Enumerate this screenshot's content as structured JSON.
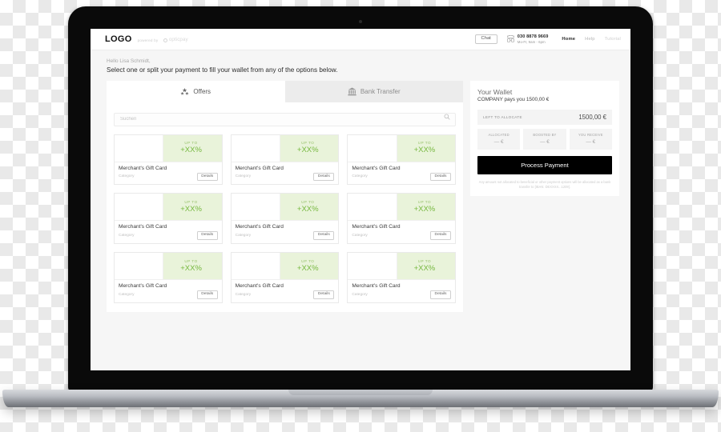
{
  "header": {
    "logo": "LOGO",
    "powered_by": "powered by",
    "provider_name": "opticpay",
    "provider_icon": "circle-logo-icon",
    "chat_label": "Chat",
    "phone_icon": "phone-support-icon",
    "phone_number": "030 8878 9669",
    "phone_hours": "Mo-Fr, 9am - 6pm",
    "nav": [
      {
        "label": "Home",
        "state": "active"
      },
      {
        "label": "Help",
        "state": "dim"
      },
      {
        "label": "Tutorial",
        "state": "dimmer"
      }
    ]
  },
  "greeting": {
    "hello": "Hello Lisa Schmidt,",
    "instruction": "Select one or split your payment to fill your wallet from any of the options below."
  },
  "tabs": [
    {
      "label": "Offers",
      "icon": "stars-icon",
      "active": true
    },
    {
      "label": "Bank Transfer",
      "icon": "bank-icon",
      "active": false
    }
  ],
  "search": {
    "placeholder": "Suchen",
    "value": "",
    "icon": "search-icon"
  },
  "offers": {
    "card_template": {
      "boost_prefix": "UP TO",
      "boost_value": "+XX%",
      "title": "Merchant's Gift Card",
      "category": "Category",
      "details_label": "Details"
    },
    "cards": [
      {
        "boost_prefix": "UP TO",
        "boost_value": "+XX%",
        "title": "Merchant's Gift Card",
        "category": "Category",
        "details_label": "Details"
      },
      {
        "boost_prefix": "UP TO",
        "boost_value": "+XX%",
        "title": "Merchant's Gift Card",
        "category": "Category",
        "details_label": "Details"
      },
      {
        "boost_prefix": "UP TO",
        "boost_value": "+XX%",
        "title": "Merchant's Gift Card",
        "category": "Category",
        "details_label": "Details"
      },
      {
        "boost_prefix": "UP TO",
        "boost_value": "+XX%",
        "title": "Merchant's Gift Card",
        "category": "Category",
        "details_label": "Details"
      },
      {
        "boost_prefix": "UP TO",
        "boost_value": "+XX%",
        "title": "Merchant's Gift Card",
        "category": "Category",
        "details_label": "Details"
      },
      {
        "boost_prefix": "UP TO",
        "boost_value": "+XX%",
        "title": "Merchant's Gift Card",
        "category": "Category",
        "details_label": "Details"
      },
      {
        "boost_prefix": "UP TO",
        "boost_value": "+XX%",
        "title": "Merchant's Gift Card",
        "category": "Category",
        "details_label": "Details"
      },
      {
        "boost_prefix": "UP TO",
        "boost_value": "+XX%",
        "title": "Merchant's Gift Card",
        "category": "Category",
        "details_label": "Details"
      },
      {
        "boost_prefix": "UP TO",
        "boost_value": "+XX%",
        "title": "Merchant's Gift Card",
        "category": "Category",
        "details_label": "Details"
      }
    ]
  },
  "wallet": {
    "title": "Your Wallet",
    "subtitle": "COMPANY pays you 1500,00 €",
    "left_to_allocate_label": "LEFT TO ALLOCATE",
    "left_to_allocate_amount": "1500,00 €",
    "stats": [
      {
        "label": "ALLOCATED",
        "value": "— €"
      },
      {
        "label": "BOOSTED BY",
        "value": "— €"
      },
      {
        "label": "YOU RECEIVE",
        "value": "— €"
      }
    ],
    "process_payment_label": "Process Payment",
    "disclaimer": "Any amount not allocated to beneficial or other payment options will be allocated as a bank transfer to [IBAN: DEXXXX...1209]."
  },
  "colors": {
    "boost_background": "#e9f3da",
    "boost_text": "#76b83f",
    "primary_button": "#000000",
    "panel_background": "#ffffff",
    "screen_background": "#f6f6f6"
  }
}
